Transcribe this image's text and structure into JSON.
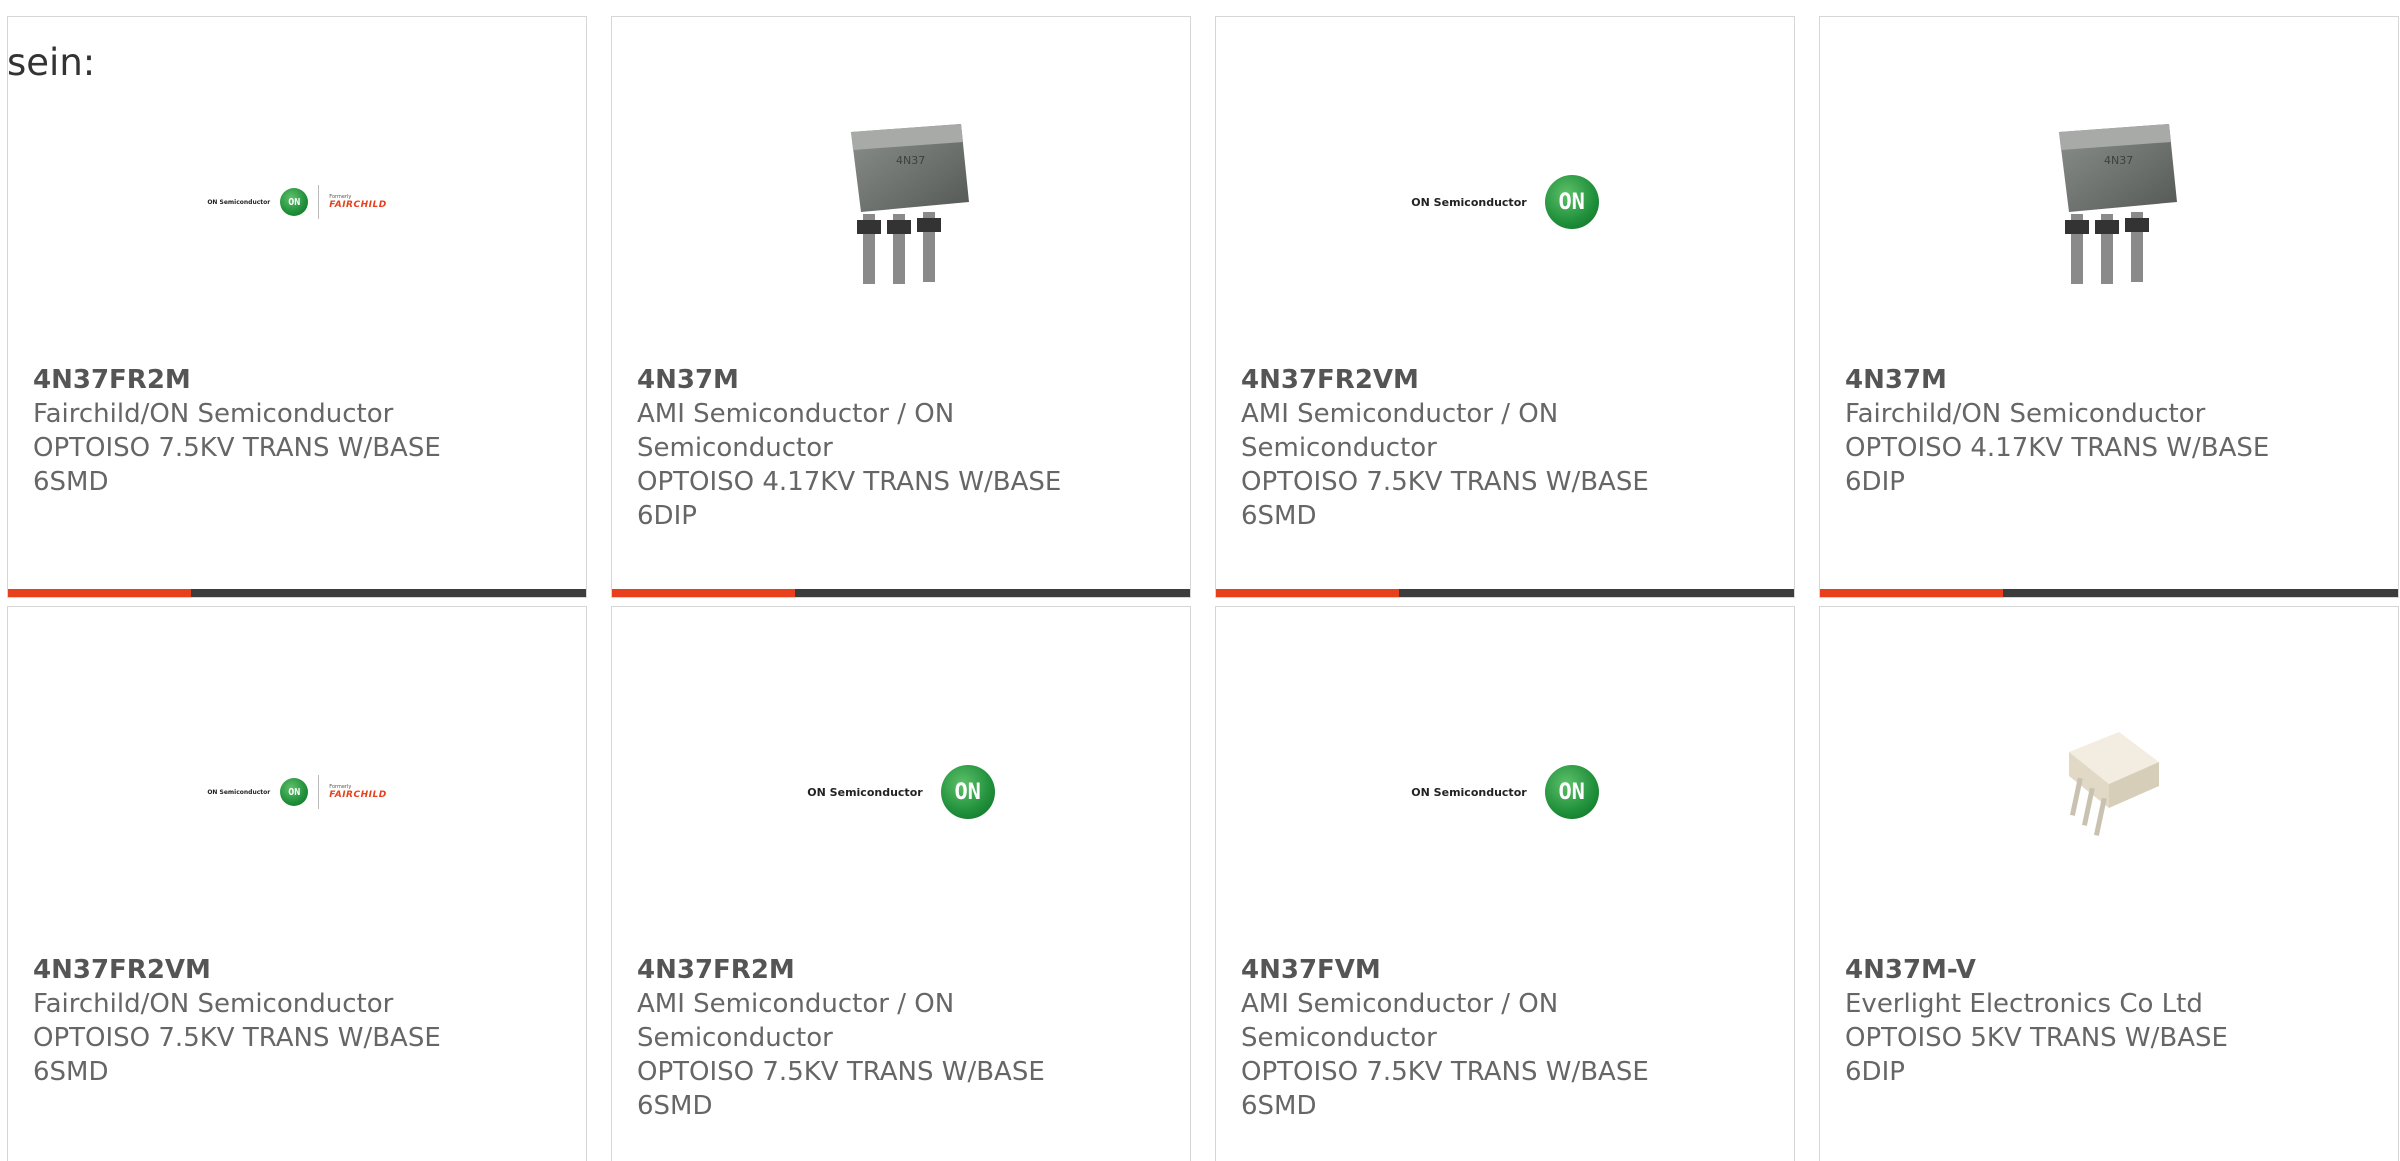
{
  "heading": "sein:",
  "cards": [
    {
      "part": "4N37FR2M",
      "lines": [
        "Fairchild/ON Semiconductor",
        "OPTOISO 7.5KV TRANS W/BASE",
        "6SMD"
      ],
      "image": "onsemi-fairchild-logo"
    },
    {
      "part": "4N37M",
      "lines": [
        "AMI Semiconductor / ON",
        "Semiconductor",
        "OPTOISO 4.17KV TRANS W/BASE",
        "6DIP"
      ],
      "image": "gray-dip-package-photo"
    },
    {
      "part": "4N37FR2VM",
      "lines": [
        "AMI Semiconductor / ON",
        "Semiconductor",
        "OPTOISO 7.5KV TRANS W/BASE",
        "6SMD"
      ],
      "image": "onsemi-logo"
    },
    {
      "part": "4N37M",
      "lines": [
        "Fairchild/ON Semiconductor",
        "OPTOISO 4.17KV TRANS W/BASE",
        "6DIP"
      ],
      "image": "gray-dip-package-photo"
    },
    {
      "part": "4N37FR2VM",
      "lines": [
        "Fairchild/ON Semiconductor",
        "OPTOISO 7.5KV TRANS W/BASE",
        "6SMD"
      ],
      "image": "onsemi-fairchild-logo"
    },
    {
      "part": "4N37FR2M",
      "lines": [
        "AMI Semiconductor / ON",
        "Semiconductor",
        "OPTOISO 7.5KV TRANS W/BASE",
        "6SMD"
      ],
      "image": "onsemi-logo"
    },
    {
      "part": "4N37FVM",
      "lines": [
        "AMI Semiconductor / ON",
        "Semiconductor",
        "OPTOISO 7.5KV TRANS W/BASE",
        "6SMD"
      ],
      "image": "onsemi-logo"
    },
    {
      "part": "4N37M-V",
      "lines": [
        "Everlight Electronics Co Ltd",
        "OPTOISO 5KV TRANS W/BASE",
        "6DIP"
      ],
      "image": "white-dip-package-photo"
    }
  ],
  "logos": {
    "on_semiconductor_text": "ON Semiconductor",
    "on_badge": "ON",
    "formerly": "Formerly",
    "fairchild": "FAIRCHILD",
    "chip_marking": "4N37"
  },
  "colors": {
    "accent": "#e8401c",
    "bar": "#3c3c3c",
    "on_green": "#1f8f3a"
  }
}
